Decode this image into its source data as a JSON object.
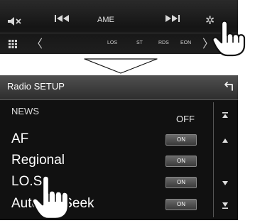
{
  "top_controls": {
    "source_label": "AME",
    "indicators": [
      "LOS",
      "ST",
      "RDS",
      "EON"
    ]
  },
  "radio_setup": {
    "title": "Radio SETUP",
    "items": [
      {
        "label": "NEWS",
        "value": "OFF"
      },
      {
        "label": "AF",
        "value": "ON"
      },
      {
        "label": "Regional",
        "value": "ON"
      },
      {
        "label": "LO.S",
        "value": "ON"
      },
      {
        "label": "Auto TP Seek",
        "value": "ON"
      }
    ]
  },
  "icons": {
    "mute": "mute-icon",
    "previous": "previous-icon",
    "next": "next-icon",
    "settings": "gear-icon",
    "menu": "grid-icon",
    "page_back": "chevron-left-icon",
    "page_forward": "chevron-right-icon",
    "return": "return-icon",
    "scroll_top": "scroll-top-icon",
    "scroll_up": "scroll-up-icon",
    "scroll_down": "scroll-down-icon",
    "scroll_bottom": "scroll-bottom-icon",
    "pointer": "hand-pointer-icon",
    "transition": "down-arrow-icon"
  }
}
